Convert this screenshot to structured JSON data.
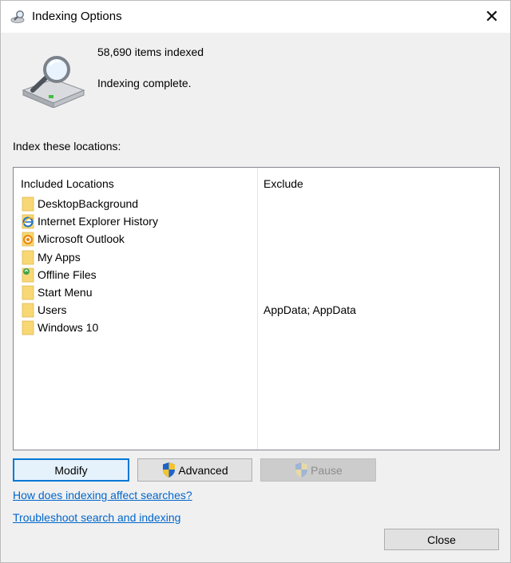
{
  "window": {
    "title": "Indexing Options",
    "close_glyph": "✕"
  },
  "summary": {
    "items_indexed": "58,690 items indexed",
    "status": "Indexing complete."
  },
  "section_label": "Index these locations:",
  "table": {
    "headers": {
      "included": "Included Locations",
      "exclude": "Exclude"
    },
    "rows": [
      {
        "name": "DesktopBackground",
        "icon": "folder-icon",
        "exclude": ""
      },
      {
        "name": "Internet Explorer History",
        "icon": "internet-explorer-icon",
        "exclude": ""
      },
      {
        "name": "Microsoft Outlook",
        "icon": "outlook-icon",
        "exclude": ""
      },
      {
        "name": "My Apps",
        "icon": "folder-icon",
        "exclude": ""
      },
      {
        "name": "Offline Files",
        "icon": "offline-files-icon",
        "exclude": ""
      },
      {
        "name": "Start Menu",
        "icon": "folder-icon",
        "exclude": ""
      },
      {
        "name": "Users",
        "icon": "folder-icon",
        "exclude": "AppData; AppData"
      },
      {
        "name": "Windows 10",
        "icon": "folder-icon",
        "exclude": ""
      }
    ]
  },
  "buttons": {
    "modify": "Modify",
    "advanced": "Advanced",
    "pause": "Pause",
    "close": "Close"
  },
  "links": {
    "how_indexing": "How does indexing affect searches?",
    "troubleshoot": "Troubleshoot search and indexing"
  },
  "colors": {
    "accent": "#0078d7",
    "link": "#0066cc",
    "folder": "#f8d775"
  }
}
